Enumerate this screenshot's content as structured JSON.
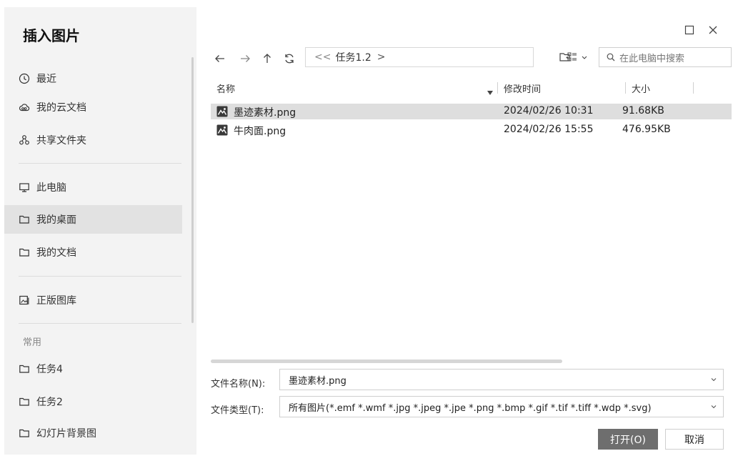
{
  "dialog": {
    "title": "插入图片",
    "controls": {
      "maximize_icon": "maximize-icon",
      "close_icon": "close-icon"
    }
  },
  "sidebar": {
    "items": [
      {
        "label": "最近",
        "icon": "clock-icon"
      },
      {
        "label": "我的云文档",
        "icon": "cloud-icon"
      },
      {
        "label": "共享文件夹",
        "icon": "share-icon"
      },
      {
        "label": "此电脑",
        "icon": "computer-icon"
      },
      {
        "label": "我的桌面",
        "icon": "folder-icon",
        "selected": true
      },
      {
        "label": "我的文档",
        "icon": "folder-icon"
      },
      {
        "label": "正版图库",
        "icon": "image-library-icon"
      }
    ],
    "section_label": "常用",
    "recent_folders": [
      {
        "label": "任务4",
        "icon": "folder-icon"
      },
      {
        "label": "任务2",
        "icon": "folder-icon"
      },
      {
        "label": "幻灯片背景图",
        "icon": "folder-icon"
      }
    ]
  },
  "toolbar": {
    "path_prefix": "<<",
    "path": "任务1.2",
    "path_suffix": ">",
    "search_placeholder": "在此电脑中搜索"
  },
  "columns": {
    "name": "名称",
    "modified": "修改时间",
    "size": "大小"
  },
  "files": [
    {
      "name": "墨迹素材.png",
      "modified": "2024/02/26 10:31",
      "size": "91.68KB",
      "selected": true
    },
    {
      "name": "牛肉面.png",
      "modified": "2024/02/26 15:55",
      "size": "476.95KB",
      "selected": false
    }
  ],
  "form": {
    "filename_label": "文件名称(N):",
    "filename_value": "墨迹素材.png",
    "filetype_label": "文件类型(T):",
    "filetype_value": "所有图片(*.emf *.wmf *.jpg *.jpeg *.jpe *.png *.bmp *.gif *.tif *.tiff *.wdp *.svg)"
  },
  "buttons": {
    "open": "打开(O)",
    "cancel": "取消"
  },
  "colors": {
    "primary_button": "#6e6e6e",
    "selection": "#dedede",
    "sidebar_bg": "#f3f3f3"
  }
}
